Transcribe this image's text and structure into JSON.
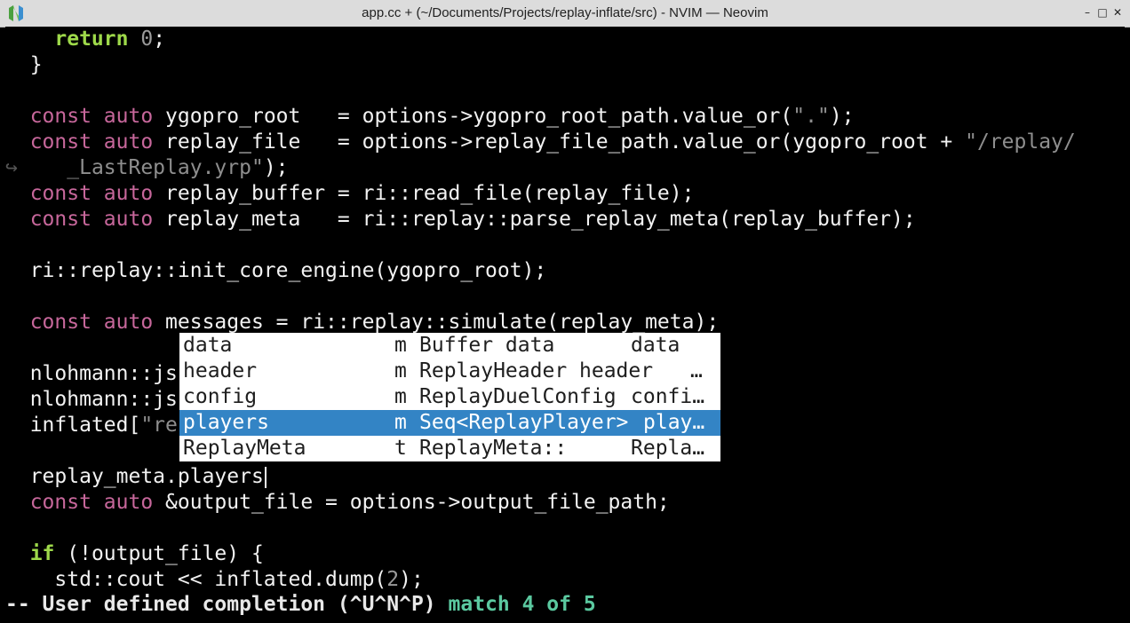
{
  "window": {
    "title": "app.cc + (~/Documents/Projects/replay-inflate/src) - NVIM — Neovim",
    "controls": [
      "–",
      "□",
      "✕"
    ]
  },
  "editor": {
    "wrap_marker": "↪",
    "lines": {
      "l0": {
        "kw": "return",
        "num": "0",
        "rest": ";"
      },
      "l1": "}",
      "l3": {
        "kw": "const auto",
        "pre": "ygopro_root   = options->ygopro_root_path.value_or(",
        "str": "\".\"",
        "post": ");"
      },
      "l4": {
        "kw": "const auto",
        "pre": "replay_file   = options->replay_file_path.value_or(ygopro_root + ",
        "str": "\"/replay/"
      },
      "l5": {
        "str": "_LastReplay.yrp\"",
        "post": ");"
      },
      "l6": {
        "kw": "const auto",
        "rest": "replay_buffer = ri::read_file(replay_file);"
      },
      "l7": {
        "kw": "const auto",
        "rest": "replay_meta   = ri::replay::parse_replay_meta(replay_buffer);"
      },
      "l9": "ri::replay::init_core_engine(ygopro_root);",
      "l11": {
        "kw": "const auto",
        "rest": "messages = ri::replay::simulate(replay_meta);"
      },
      "l13": "nlohmann::js",
      "l14": "nlohmann::js",
      "l15": {
        "pre": "inflated[",
        "str": "\"re"
      },
      "l17": "replay_meta.players",
      "l18": {
        "kw": "const auto",
        "rest": "&output_file = options->output_file_path;"
      },
      "l20": {
        "kw": "if",
        "rest": " (!output_file) {"
      },
      "l21": {
        "pre": "std::cout << inflated.dump(",
        "num": "2",
        "post": ");"
      }
    }
  },
  "completion": {
    "items": [
      {
        "word": "data",
        "kind": "m",
        "menu": "Buffer data",
        "info": "data"
      },
      {
        "word": "header",
        "kind": "m",
        "menu": "ReplayHeader header",
        "info": "…"
      },
      {
        "word": "config",
        "kind": "m",
        "menu": "ReplayDuelConfig",
        "info": "confi…"
      },
      {
        "word": "players",
        "kind": "m",
        "menu": "Seq<ReplayPlayer>",
        "info": "play…"
      },
      {
        "word": "ReplayMeta",
        "kind": "t",
        "menu": "ReplayMeta::",
        "info": "Repla…"
      }
    ],
    "selected_index": 3
  },
  "statusline": {
    "mode": "-- User defined completion (^U^N^P)",
    "match": "match 4 of 5"
  },
  "colors": {
    "keyword": "#c7679b",
    "control_keyword": "#9ed94a",
    "popup_selected": "#3384c5",
    "match_text": "#5bc9a0"
  }
}
